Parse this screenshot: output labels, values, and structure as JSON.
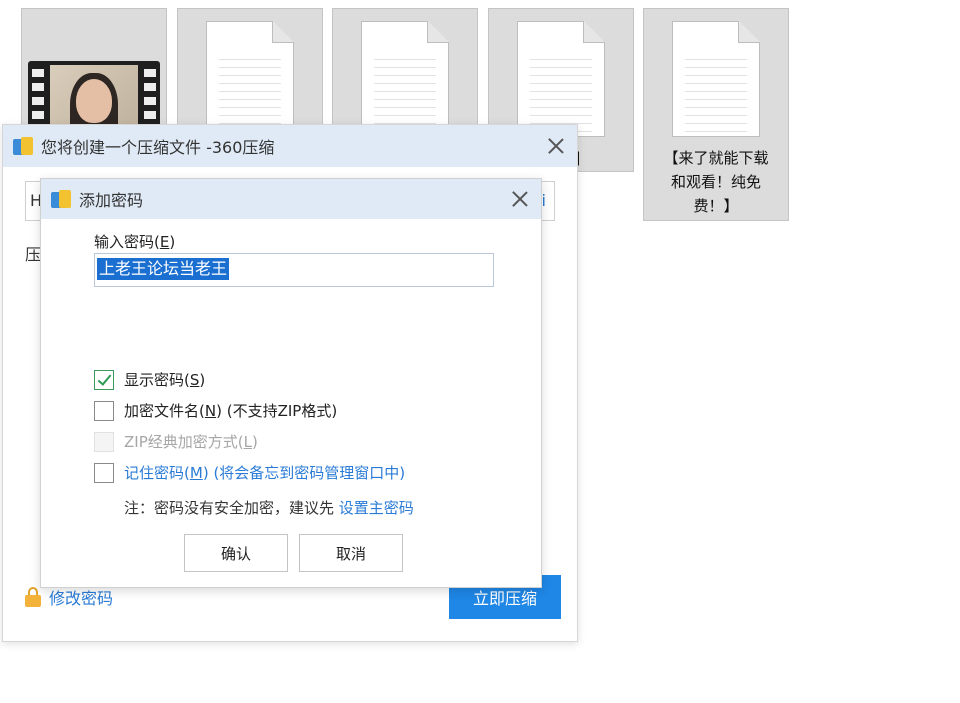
{
  "background_files": {
    "captions": [
      "绍】",
      "【来了就能下载和观看！纯免费！】"
    ]
  },
  "outer_dialog": {
    "title": "您将创建一个压缩文件 -360压缩",
    "path_fragment_left": "H",
    "path_fragment_right": "i",
    "compress_label_fragment": "压",
    "change_password_link": "修改密码",
    "compress_now_button": "立即压缩"
  },
  "password_dialog": {
    "title": "添加密码",
    "input_label": "输入密码(",
    "input_label_key": "E",
    "input_label_end": ")",
    "password_value": "上老王论坛当老王",
    "options": [
      {
        "label": "显示密码(",
        "key": "S",
        "end": ")",
        "suffix": "",
        "checked": true,
        "enabled": true,
        "link": false
      },
      {
        "label": "加密文件名(",
        "key": "N",
        "end": ")",
        "suffix": " (不支持ZIP格式)",
        "checked": false,
        "enabled": true,
        "link": false
      },
      {
        "label": "ZIP经典加密方式(",
        "key": "L",
        "end": ")",
        "suffix": "",
        "checked": false,
        "enabled": false,
        "link": false
      },
      {
        "label": "记住密码(",
        "key": "M",
        "end": ")",
        "suffix": " (将会备忘到密码管理窗口中)",
        "checked": false,
        "enabled": true,
        "link": true
      }
    ],
    "note_text": "注：密码没有安全加密，建议先 ",
    "note_link": "设置主密码",
    "ok_button": "确认",
    "cancel_button": "取消"
  },
  "colors": {
    "titlebar": "#dfeaf6",
    "accent_blue": "#1f87e6",
    "link_blue": "#2a7bd6",
    "check_green": "#2e9a54"
  }
}
